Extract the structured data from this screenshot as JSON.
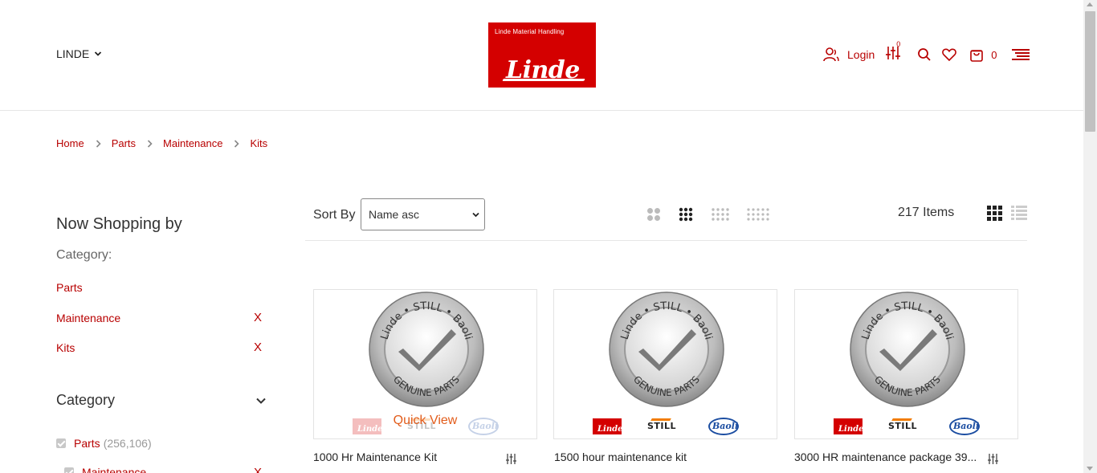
{
  "header": {
    "store_switcher": "LINDE",
    "logo": {
      "subtitle": "Linde Material Handling",
      "wordmark": "Linde"
    },
    "login_label": "Login",
    "compare_count": "0",
    "cart_count": "0"
  },
  "breadcrumb": [
    "Home",
    "Parts",
    "Maintenance",
    "Kits"
  ],
  "sidebar": {
    "now_shopping_title": "Now Shopping by",
    "category_label": "Category:",
    "active_filters": [
      {
        "name": "Parts",
        "removable": false
      },
      {
        "name": "Maintenance",
        "removable": true,
        "remove_label": "X"
      },
      {
        "name": "Kits",
        "removable": true,
        "remove_label": "X"
      }
    ],
    "category_section_title": "Category",
    "category_items": [
      {
        "name": "Parts",
        "count": "(256,106)"
      },
      {
        "name": "Maintenance",
        "count": "",
        "remove_label": "X"
      }
    ]
  },
  "toolbar": {
    "sort_label": "Sort By",
    "sort_value": "Name asc",
    "items_count": "217 Items"
  },
  "badge_text": {
    "top": "STILL",
    "left": "Linde",
    "right": "Baoli",
    "bottom": "GENUINE PARTS"
  },
  "brands": {
    "linde": "Linde",
    "still": "STILL",
    "baoli": "Baoli"
  },
  "products": [
    {
      "name": "1000 Hr Maintenance Kit",
      "quick_view": "Quick View"
    },
    {
      "name": "1500 hour maintenance kit"
    },
    {
      "name": "3000 HR maintenance package 39..."
    }
  ],
  "colors": {
    "brand_red": "#b80000",
    "logo_red": "#d40000",
    "quick_view_orange": "#e25c1b"
  }
}
